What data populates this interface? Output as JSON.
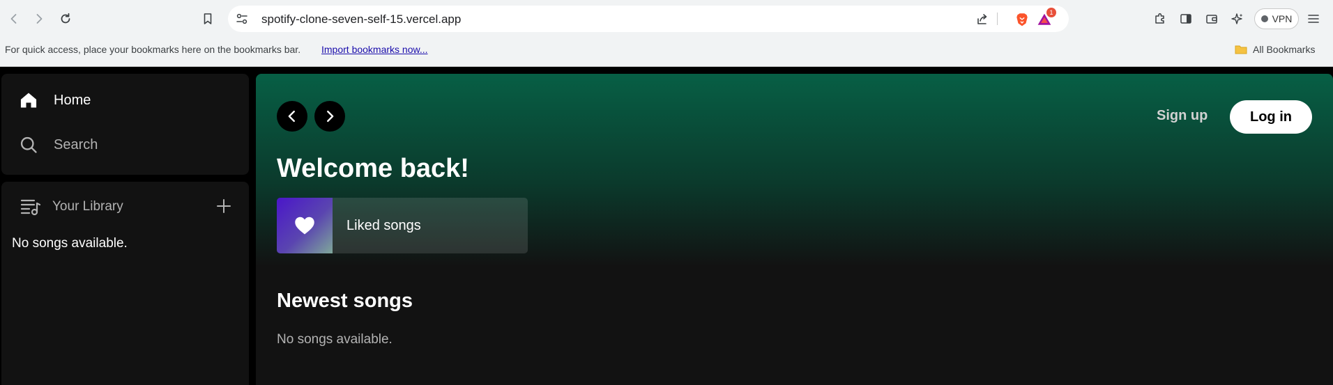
{
  "browser": {
    "url": "spotify-clone-seven-self-15.vercel.app",
    "vpn_label": "VPN",
    "notification_count": "1",
    "bookmarks_bar": {
      "prompt": "For quick access, place your bookmarks here on the bookmarks bar.",
      "import_link": "Import bookmarks now...",
      "all_bookmarks": "All Bookmarks"
    }
  },
  "sidebar": {
    "nav": [
      {
        "label": "Home",
        "icon": "home-icon"
      },
      {
        "label": "Search",
        "icon": "search-icon"
      }
    ],
    "library": {
      "title": "Your Library",
      "empty_text": "No songs available."
    }
  },
  "main": {
    "header": {
      "signup_label": "Sign up",
      "login_label": "Log in"
    },
    "welcome": "Welcome back!",
    "liked_card": {
      "label": "Liked songs"
    },
    "newest": {
      "title": "Newest songs",
      "empty_text": "No songs available."
    }
  },
  "colors": {
    "accent_green": "#075f45",
    "panel": "#121212",
    "text_muted": "#b3b3b3"
  }
}
